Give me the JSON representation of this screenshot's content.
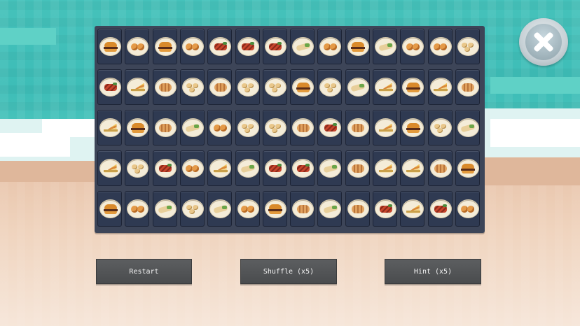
{
  "board": {
    "rows": [
      [
        "burger",
        "eggs",
        "burger",
        "eggs",
        "steak",
        "steak",
        "steak",
        "wrap",
        "eggs",
        "burger",
        "wrap",
        "eggs",
        "eggs",
        "potato"
      ],
      [
        "steak",
        "sandwich",
        "chicken",
        "potato",
        "chicken",
        "potato",
        "potato",
        "burger",
        "potato",
        "wrap",
        "sandwich",
        "burger",
        "sandwich",
        "chicken"
      ],
      [
        "sandwich",
        "burger",
        "chicken",
        "wrap",
        "eggs",
        "potato",
        "potato",
        "chicken",
        "steak",
        "chicken",
        "sandwich",
        "burger",
        "potato",
        "wrap"
      ],
      [
        "sandwich",
        "potato",
        "steak",
        "eggs",
        "sandwich",
        "wrap",
        "steak",
        "steak",
        "wrap",
        "chicken",
        "sandwich",
        "sandwich",
        "chicken",
        "burger"
      ],
      [
        "burger",
        "eggs",
        "wrap",
        "potato",
        "wrap",
        "eggs",
        "burger",
        "chicken",
        "wrap",
        "chicken",
        "steak",
        "sandwich",
        "steak",
        "eggs"
      ]
    ]
  },
  "close_button": {
    "icon": "close-icon"
  },
  "buttons": {
    "restart": "Restart",
    "shuffle": "Shuffle (x5)",
    "hint": "Hint (x5)"
  },
  "colors": {
    "sea": "#3dbdb7",
    "sand": "#efd3bd",
    "board": "#3d4558",
    "tile": "#2f3a52",
    "button": "#505254"
  }
}
